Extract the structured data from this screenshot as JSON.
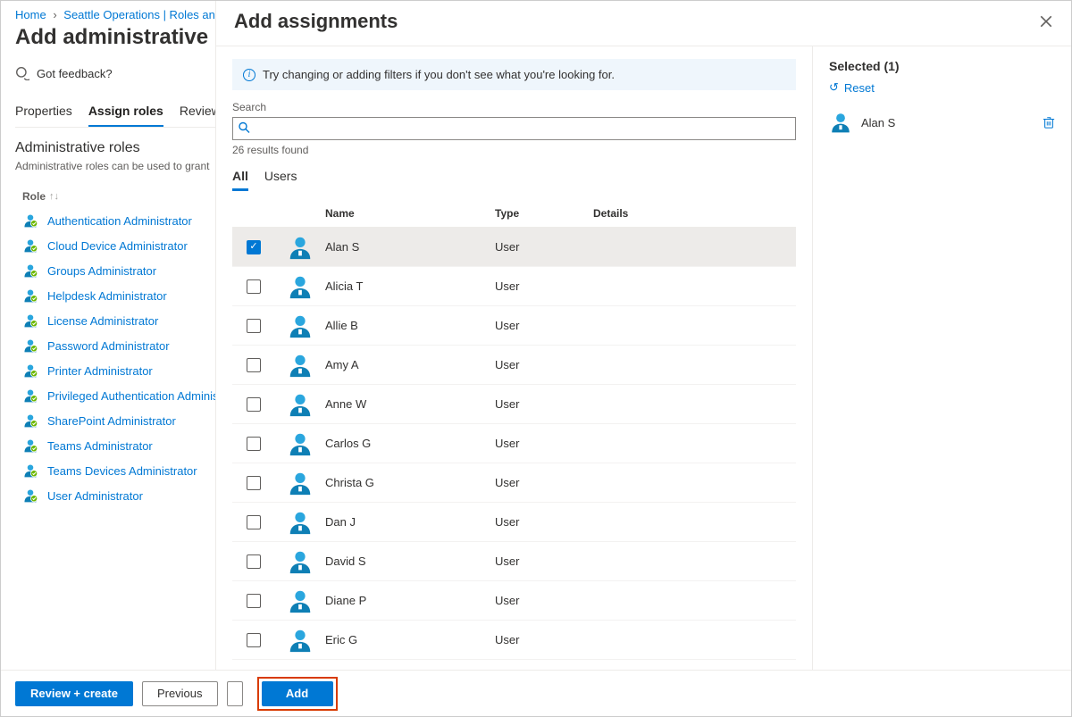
{
  "breadcrumb": {
    "home": "Home",
    "parent": "Seattle Operations | Roles and"
  },
  "page_title": "Add administrative uni",
  "feedback": "Got feedback?",
  "main_tabs": [
    "Properties",
    "Assign roles",
    "Review"
  ],
  "main_tabs_active_index": 1,
  "section": {
    "title": "Administrative roles",
    "subtitle": "Administrative roles can be used to grant"
  },
  "role_col_label": "Role",
  "roles": [
    "Authentication Administrator",
    "Cloud Device Administrator",
    "Groups Administrator",
    "Helpdesk Administrator",
    "License Administrator",
    "Password Administrator",
    "Printer Administrator",
    "Privileged Authentication Administ",
    "SharePoint Administrator",
    "Teams Administrator",
    "Teams Devices Administrator",
    "User Administrator"
  ],
  "footer": {
    "review_create": "Review + create",
    "previous": "Previous",
    "add": "Add"
  },
  "panel": {
    "title": "Add assignments",
    "info": "Try changing or adding filters if you don't see what you're looking for.",
    "search_label": "Search",
    "search_placeholder": "",
    "result_count": "26 results found",
    "type_tabs": [
      "All",
      "Users"
    ],
    "type_tabs_active_index": 0,
    "grid_headers": {
      "name": "Name",
      "type": "Type",
      "details": "Details"
    },
    "rows": [
      {
        "name": "Alan S",
        "type": "User",
        "selected": true
      },
      {
        "name": "Alicia T",
        "type": "User",
        "selected": false
      },
      {
        "name": "Allie B",
        "type": "User",
        "selected": false
      },
      {
        "name": "Amy A",
        "type": "User",
        "selected": false
      },
      {
        "name": "Anne W",
        "type": "User",
        "selected": false
      },
      {
        "name": "Carlos G",
        "type": "User",
        "selected": false
      },
      {
        "name": "Christa G",
        "type": "User",
        "selected": false
      },
      {
        "name": "Dan J",
        "type": "User",
        "selected": false
      },
      {
        "name": "David S",
        "type": "User",
        "selected": false
      },
      {
        "name": "Diane P",
        "type": "User",
        "selected": false
      },
      {
        "name": "Eric G",
        "type": "User",
        "selected": false
      }
    ],
    "selected_heading": "Selected (1)",
    "reset": "Reset",
    "selected_items": [
      {
        "name": "Alan S"
      }
    ]
  }
}
